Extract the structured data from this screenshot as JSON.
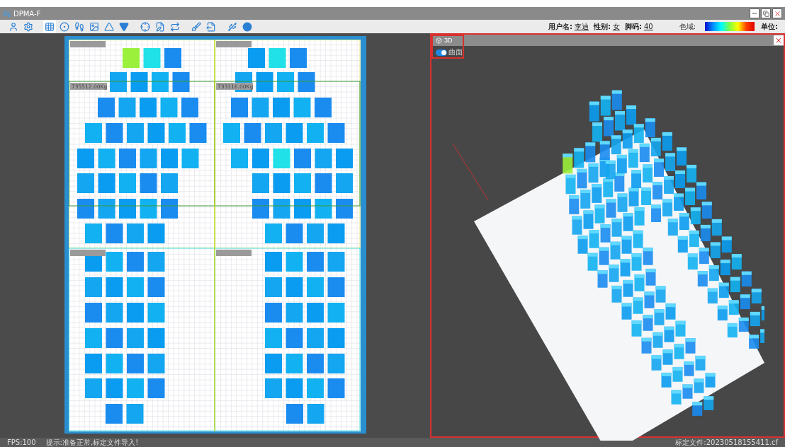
{
  "window": {
    "title": "DPMA-F"
  },
  "user_info": {
    "username_label": "用户名:",
    "username": "李迪",
    "gender_label": "性别:",
    "gender": "女",
    "size_label": "脚码:",
    "size": "40",
    "color_range_label": "色域:",
    "unit_label": "单位:"
  },
  "pressure_map": {
    "region_labels": [
      "735512.00Kg",
      "733116.00Kg"
    ]
  },
  "view3d": {
    "tab": "3D",
    "toggle": {
      "label": "曲面",
      "on": true
    }
  },
  "status_bar": {
    "fps": "FPS:100",
    "message": "提示:准备正常,标定文件导入!",
    "calibration_file": "标定文件:20230518155411.cf"
  }
}
